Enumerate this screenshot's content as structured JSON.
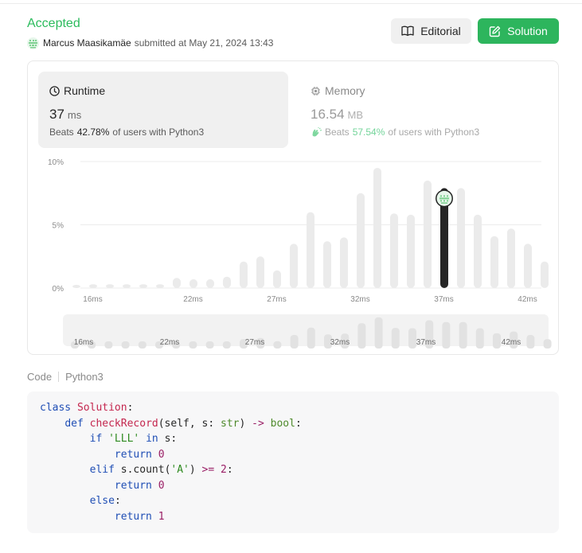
{
  "header": {
    "status": "Accepted",
    "username": "Marcus Maasikamäe",
    "submitted_text": "submitted at May 21, 2024 13:43",
    "editorial_label": "Editorial",
    "solution_label": "Solution"
  },
  "runtime": {
    "title": "Runtime",
    "value": "37",
    "unit": "ms",
    "beats_prefix": "Beats",
    "beats_pct": "42.78%",
    "beats_suffix": "of users with Python3"
  },
  "memory": {
    "title": "Memory",
    "value": "16.54",
    "unit": "MB",
    "beats_prefix": "Beats",
    "beats_pct": "57.54%",
    "beats_suffix": "of users with Python3"
  },
  "chart_data": {
    "type": "bar",
    "x": [
      15,
      16,
      17,
      18,
      19,
      20,
      21,
      22,
      23,
      24,
      25,
      26,
      27,
      28,
      29,
      30,
      31,
      32,
      33,
      34,
      35,
      36,
      37,
      38,
      39,
      40,
      41,
      42,
      43
    ],
    "values": [
      0.2,
      0.3,
      0.3,
      0.3,
      0.3,
      0.3,
      0.8,
      0.7,
      0.7,
      0.9,
      2.1,
      2.5,
      1.4,
      3.5,
      6.0,
      3.7,
      4.0,
      7.5,
      9.5,
      5.9,
      5.8,
      8.5,
      7.9,
      7.9,
      5.8,
      4.1,
      4.7,
      3.5,
      2.1
    ],
    "highlight_x": 37,
    "x_tick_labels": [
      "16ms",
      "22ms",
      "27ms",
      "32ms",
      "37ms",
      "42ms"
    ],
    "x_tick_values": [
      16,
      22,
      27,
      32,
      37,
      42
    ],
    "y_tick_labels": [
      "0%",
      "5%",
      "10%"
    ],
    "y_tick_values": [
      0,
      5,
      10
    ],
    "ylim": [
      0,
      10
    ],
    "grid": true,
    "minimap_tick_labels": [
      "16ms",
      "22ms",
      "27ms",
      "32ms",
      "37ms",
      "42ms"
    ]
  },
  "code": {
    "tab_label": "Code",
    "language": "Python3",
    "lines": [
      "class Solution:",
      "    def checkRecord(self, s: str) -> bool:",
      "        if 'LLL' in s:",
      "            return 0",
      "        elif s.count('A') >= 2:",
      "            return 0",
      "        else:",
      "            return 1"
    ]
  },
  "colors": {
    "accent": "#2cbb5d",
    "highlight_bar": "#262626",
    "bar": "#ebebeb"
  },
  "icons": {
    "editorial": "book-open-icon",
    "solution": "edit-square-icon",
    "runtime": "clock-icon",
    "memory": "chip-icon",
    "beats": "clap-hands-icon",
    "avatar": "avatar-icon"
  }
}
